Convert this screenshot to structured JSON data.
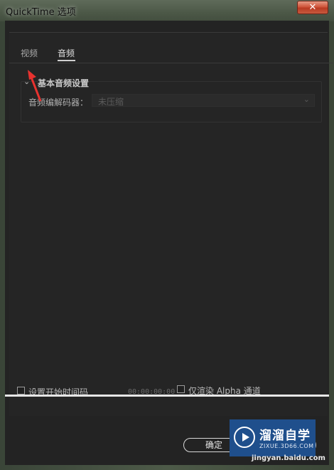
{
  "window": {
    "title": "QuickTime 选项",
    "close_label": "✕"
  },
  "tabs": [
    {
      "label": "视频"
    },
    {
      "label": "音频"
    }
  ],
  "section": {
    "chevron": "⌄",
    "title": "基本音频设置",
    "codec_label": "音频编解码器：",
    "codec_value": "未压缩",
    "caret": "⌄"
  },
  "footer": {
    "set_timecode_label": "设置开始时间码",
    "timecode": "00:00:00:00",
    "alpha_label": "仅渲染  Alpha 通道",
    "ok_label": "确定"
  },
  "watermark": {
    "title": "溜溜自学",
    "domain": "ZIXUE.3D66.COM",
    "url": "jingyan.baidu.com"
  },
  "colors": {
    "accent_arrow": "#e8322f",
    "panel_bg": "#252525",
    "watermark_bg": "#1f4f8c"
  },
  "icons": {
    "close": "close-icon",
    "chevron": "chevron-down-icon",
    "arrow": "red-arrow-annotation"
  }
}
